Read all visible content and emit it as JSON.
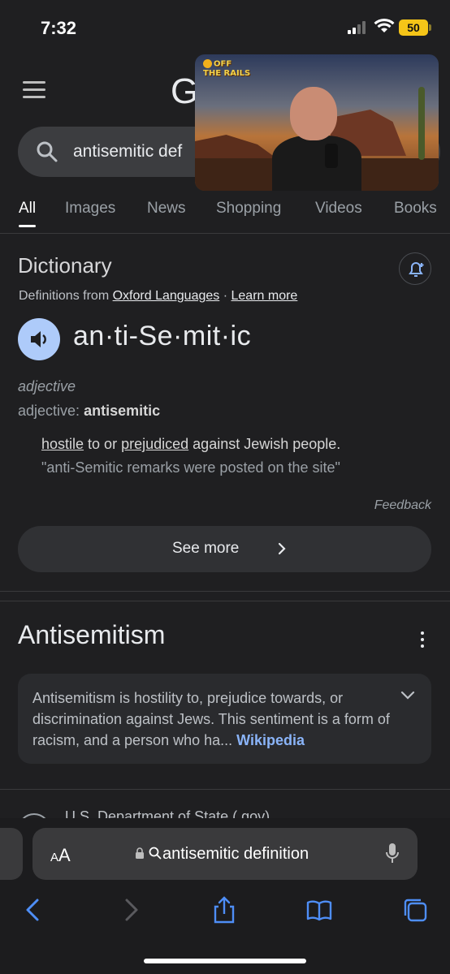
{
  "status": {
    "time": "7:32",
    "battery": "50"
  },
  "search": {
    "query": "antisemitic def"
  },
  "tabs": [
    "All",
    "Images",
    "News",
    "Shopping",
    "Videos",
    "Books"
  ],
  "video": {
    "overlay_logo_line1": "OFF",
    "overlay_logo_line2": "THE RAILS"
  },
  "dictionary": {
    "title": "Dictionary",
    "source_prefix": "Definitions from",
    "source_link": "Oxford Languages",
    "separator": "·",
    "learn_more": "Learn more",
    "word": "an·ti-Se·mit·ic",
    "pos": "adjective",
    "pos_label": "adjective:",
    "pos_value": "antisemitic",
    "definition_word1": "hostile",
    "definition_mid": "to or",
    "definition_word2": "prejudiced",
    "definition_end": "against Jewish people.",
    "example": "\"anti-Semitic remarks were posted on the site\"",
    "feedback": "Feedback",
    "see_more": "See more"
  },
  "knowledge": {
    "title": "Antisemitism",
    "snippet": "Antisemitism is hostility to, prejudice towards, or discrimination against Jews. This sentiment is a form of racism, and a person who ha",
    "ellipsis": "...",
    "source": "Wikipedia"
  },
  "next_result": {
    "title": "U.S. Department of State (.gov)"
  },
  "browser": {
    "aa_big": "A",
    "aa_small": "A",
    "url": "antisemitic definition"
  },
  "colors": {
    "link_blue": "#8ab4f8",
    "battery_yellow": "#f5c518",
    "speaker_bg": "#aecbfa"
  }
}
